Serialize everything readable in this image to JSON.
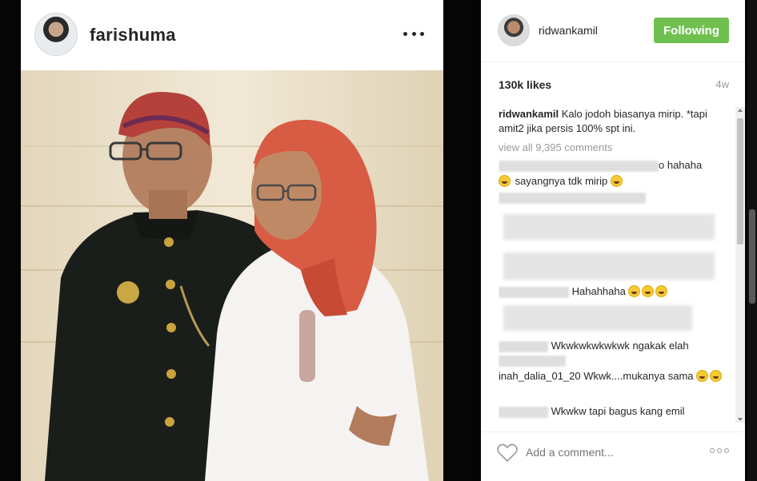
{
  "post": {
    "author": "farishuma",
    "options_icon": "more-dots-icon"
  },
  "side": {
    "account": "ridwankamil",
    "follow_label": "Following",
    "likes": "130k likes",
    "age": "4w",
    "caption_user": "ridwankamil",
    "caption_text": "Kalo jodoh biasanya mirip. *tapi amit2 jika persis 100% spt ini.",
    "view_all": "view all 9,395 comments",
    "comments": [
      {
        "user": "",
        "text": "o hahaha"
      },
      {
        "user": "",
        "text": "sayangnya tdk mirip"
      },
      {
        "user": "",
        "text": "Hahahhaha"
      },
      {
        "user": "",
        "text": "Wkwkwkwkwkwk ngakak elah"
      },
      {
        "user": "",
        "text": "inah_dalia_01_20 Wkwk....mukanya sama"
      },
      {
        "user": "",
        "text": "Wkwkw tapi bagus kang emil"
      }
    ],
    "add_comment_placeholder": "Add a comment...",
    "colors": {
      "follow_green": "#70c050",
      "text": "#262626",
      "muted": "#999999"
    }
  }
}
